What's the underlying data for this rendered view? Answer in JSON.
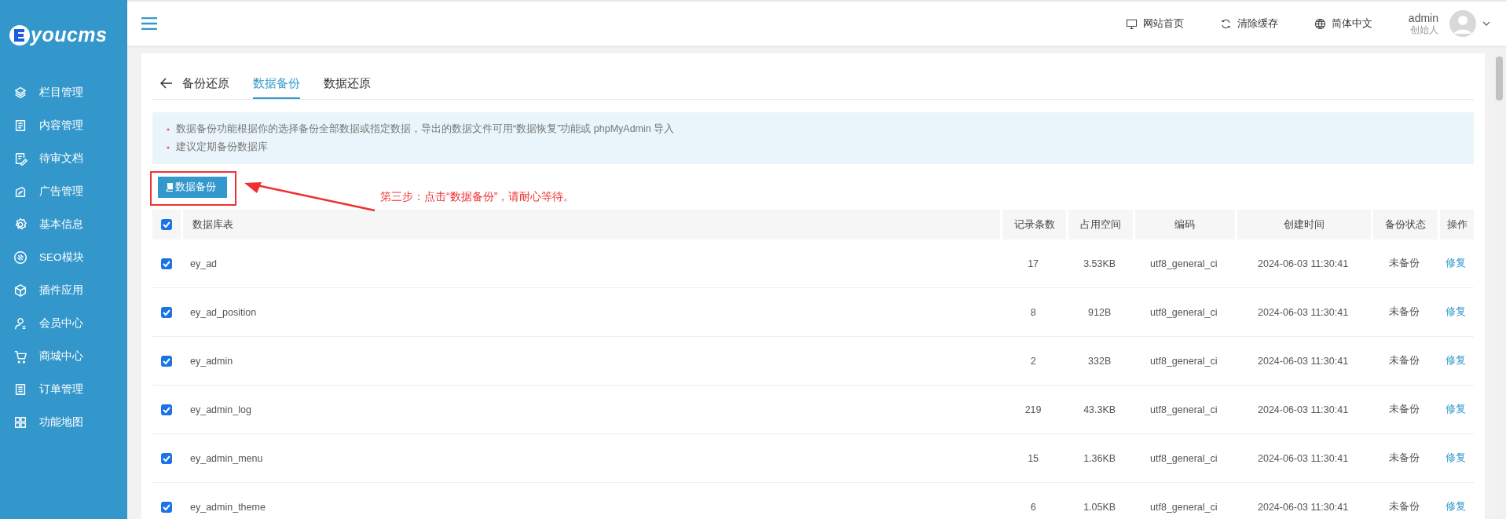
{
  "sidebar": {
    "logo": "youcms",
    "items": [
      {
        "label": "栏目管理"
      },
      {
        "label": "内容管理"
      },
      {
        "label": "待审文档"
      },
      {
        "label": "广告管理"
      },
      {
        "label": "基本信息"
      },
      {
        "label": "SEO模块"
      },
      {
        "label": "插件应用"
      },
      {
        "label": "会员中心"
      },
      {
        "label": "商城中心"
      },
      {
        "label": "订单管理"
      },
      {
        "label": "功能地图"
      }
    ]
  },
  "topbar": {
    "links": [
      "网站首页",
      "清除缓存",
      "简体中文"
    ],
    "user": {
      "name": "admin",
      "role": "创始人"
    }
  },
  "page": {
    "title": "备份还原",
    "tabs": [
      {
        "label": "数据备份",
        "selected": true
      },
      {
        "label": "数据还原",
        "selected": false
      }
    ]
  },
  "notice": [
    "数据备份功能根据你的选择备份全部数据或指定数据，导出的数据文件可用“数据恢复”功能或 phpMyAdmin 导入",
    "建议定期备份数据库"
  ],
  "backup_button": "数据备份",
  "annotation": "第三步：点击“数据备份”，请耐心等待。",
  "table": {
    "header_checked": true,
    "columns": [
      "数据库表",
      "记录条数",
      "占用空间",
      "编码",
      "创建时间",
      "备份状态",
      "操作"
    ],
    "rows": [
      {
        "checked": true,
        "name": "ey_ad",
        "records": "17",
        "size": "3.53KB",
        "encoding": "utf8_general_ci",
        "created": "2024-06-03 11:30:41",
        "status": "未备份",
        "action": "修复"
      },
      {
        "checked": true,
        "name": "ey_ad_position",
        "records": "8",
        "size": "912B",
        "encoding": "utf8_general_ci",
        "created": "2024-06-03 11:30:41",
        "status": "未备份",
        "action": "修复"
      },
      {
        "checked": true,
        "name": "ey_admin",
        "records": "2",
        "size": "332B",
        "encoding": "utf8_general_ci",
        "created": "2024-06-03 11:30:41",
        "status": "未备份",
        "action": "修复"
      },
      {
        "checked": true,
        "name": "ey_admin_log",
        "records": "219",
        "size": "43.3KB",
        "encoding": "utf8_general_ci",
        "created": "2024-06-03 11:30:41",
        "status": "未备份",
        "action": "修复"
      },
      {
        "checked": true,
        "name": "ey_admin_menu",
        "records": "15",
        "size": "1.36KB",
        "encoding": "utf8_general_ci",
        "created": "2024-06-03 11:30:41",
        "status": "未备份",
        "action": "修复"
      },
      {
        "checked": true,
        "name": "ey_admin_theme",
        "records": "6",
        "size": "1.05KB",
        "encoding": "utf8_general_ci",
        "created": "2024-06-03 11:30:41",
        "status": "未备份",
        "action": "修复"
      }
    ]
  }
}
